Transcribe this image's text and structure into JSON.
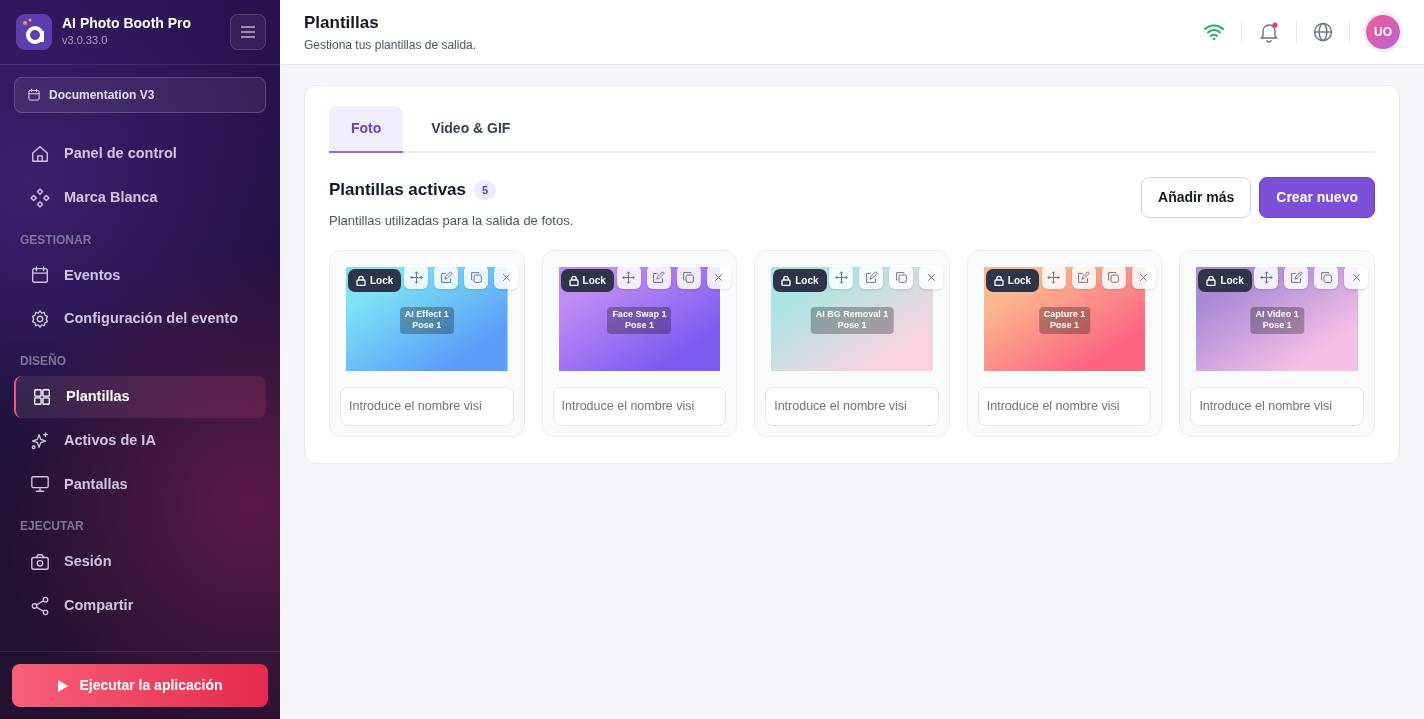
{
  "app": {
    "name": "AI Photo Booth Pro",
    "version": "v3.0.33.0"
  },
  "event_selector": {
    "label": "Documentation V3"
  },
  "sidebar": {
    "sections": [
      {
        "items": [
          {
            "label": "Panel de control",
            "selected": false
          },
          {
            "label": "Marca Blanca",
            "selected": false
          }
        ]
      },
      {
        "title": "GESTIONAR",
        "items": [
          {
            "label": "Eventos",
            "selected": false
          },
          {
            "label": "Configuración del evento",
            "selected": false
          }
        ]
      },
      {
        "title": "DISEÑO",
        "items": [
          {
            "label": "Plantillas",
            "selected": true
          },
          {
            "label": "Activos de IA",
            "selected": false
          },
          {
            "label": "Pantallas",
            "selected": false
          }
        ]
      },
      {
        "title": "EJECUTAR",
        "items": [
          {
            "label": "Sesión",
            "selected": false
          },
          {
            "label": "Compartir",
            "selected": false
          }
        ]
      }
    ],
    "run_button": "Ejecutar la aplicación"
  },
  "header": {
    "title": "Plantillas",
    "subtitle": "Gestiona tus plantillas de salida.",
    "notifications_unread": true,
    "avatar": "UO"
  },
  "tabs": [
    {
      "label": "Foto",
      "selected": true
    },
    {
      "label": "Video & GIF",
      "selected": false
    }
  ],
  "section": {
    "title": "Plantillas activas",
    "count": "5",
    "description": "Plantillas utilizadas para la salida de fotos.",
    "buttons": [
      {
        "label": "Añadir más",
        "kind": "outline"
      },
      {
        "label": "Crear nuevo",
        "kind": "primary"
      }
    ]
  },
  "templates": [
    {
      "lines": [
        "AI Effect 1",
        "Pose 1"
      ],
      "gradient": [
        {
          "color": "#7ee3f6"
        },
        {
          "color": "#5b9cf8"
        }
      ],
      "badge": "Lock",
      "locked": true,
      "placeholder": "Introduce el nombre visi"
    },
    {
      "lines": [
        "Face Swap 1",
        "Pose 1"
      ],
      "gradient": [
        {
          "color": "#c08cf5"
        },
        {
          "color": "#7a5cf0"
        }
      ],
      "badge": "Lock",
      "locked": true,
      "placeholder": "Introduce el nombre visi"
    },
    {
      "lines": [
        "AI BG Removal 1",
        "Pose 1"
      ],
      "gradient": [
        {
          "color": "#a8e6e2"
        },
        {
          "color": "#f8d4e0"
        }
      ],
      "badge": "Lock",
      "locked": true,
      "placeholder": "Introduce el nombre visi"
    },
    {
      "lines": [
        "Capture 1",
        "Pose 1"
      ],
      "gradient": [
        {
          "color": "#fcb98f"
        },
        {
          "color": "#fb6582"
        }
      ],
      "badge": "Lock",
      "locked": true,
      "placeholder": "Introduce el nombre visi"
    },
    {
      "lines": [
        "AI Video 1",
        "Pose 1"
      ],
      "gradient": [
        {
          "color": "#a98ad8"
        },
        {
          "color": "#f6c0e6"
        }
      ],
      "badge": "Lock",
      "locked": true,
      "placeholder": "Introduce el nombre visi"
    }
  ]
}
